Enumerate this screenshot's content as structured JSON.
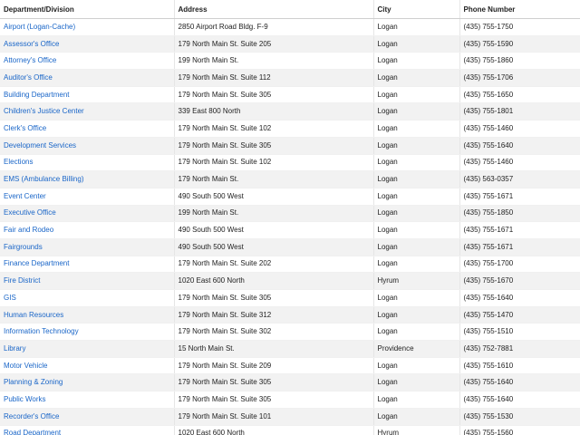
{
  "table": {
    "headers": {
      "department": "Department/Division",
      "address": "Address",
      "city": "City",
      "phone": "Phone Number"
    },
    "link_color": "#1a66c8",
    "rows": [
      {
        "department": "Airport (Logan-Cache)",
        "address": "2850 Airport Road Bldg. F-9",
        "city": "Logan",
        "phone": "(435) 755-1750"
      },
      {
        "department": "Assessor's Office",
        "address": "179 North Main St. Suite 205",
        "city": "Logan",
        "phone": "(435) 755-1590"
      },
      {
        "department": "Attorney's Office",
        "address": "199 North Main St.",
        "city": "Logan",
        "phone": "(435) 755-1860"
      },
      {
        "department": "Auditor's Office",
        "address": "179 North Main St. Suite 112",
        "city": "Logan",
        "phone": "(435) 755-1706"
      },
      {
        "department": "Building Department",
        "address": "179 North Main St. Suite 305",
        "city": "Logan",
        "phone": "(435) 755-1650"
      },
      {
        "department": "Children's Justice Center",
        "address": "339 East 800 North",
        "city": "Logan",
        "phone": "(435) 755-1801"
      },
      {
        "department": "Clerk's Office",
        "address": "179 North Main St. Suite 102",
        "city": "Logan",
        "phone": "(435) 755-1460"
      },
      {
        "department": "Development Services",
        "address": "179 North Main St. Suite 305",
        "city": "Logan",
        "phone": "(435) 755-1640"
      },
      {
        "department": "Elections",
        "address": "179 North Main St. Suite 102",
        "city": "Logan",
        "phone": "(435) 755-1460"
      },
      {
        "department": "EMS (Ambulance Billing)",
        "address": "179 North Main St.",
        "city": "Logan",
        "phone": "(435) 563-0357"
      },
      {
        "department": "Event Center",
        "address": "490 South 500 West",
        "city": "Logan",
        "phone": "(435) 755-1671"
      },
      {
        "department": "Executive Office",
        "address": "199 North Main St.",
        "city": "Logan",
        "phone": "(435) 755-1850"
      },
      {
        "department": "Fair and Rodeo",
        "address": "490 South 500 West",
        "city": "Logan",
        "phone": "(435) 755-1671"
      },
      {
        "department": "Fairgrounds",
        "address": "490 South 500 West",
        "city": "Logan",
        "phone": "(435) 755-1671"
      },
      {
        "department": "Finance Department",
        "address": "179 North Main St. Suite 202",
        "city": "Logan",
        "phone": "(435) 755-1700"
      },
      {
        "department": "Fire District",
        "address": "1020 East 600 North",
        "city": "Hyrum",
        "phone": "(435) 755-1670"
      },
      {
        "department": "GIS",
        "address": "179 North Main St. Suite 305",
        "city": "Logan",
        "phone": "(435) 755-1640"
      },
      {
        "department": "Human Resources",
        "address": "179 North Main St. Suite 312",
        "city": "Logan",
        "phone": "(435) 755-1470"
      },
      {
        "department": "Information Technology",
        "address": "179 North Main St. Suite 302",
        "city": "Logan",
        "phone": "(435) 755-1510"
      },
      {
        "department": "Library",
        "address": "15 North Main St.",
        "city": "Providence",
        "phone": "(435) 752-7881"
      },
      {
        "department": "Motor Vehicle",
        "address": "179 North Main St. Suite 209",
        "city": "Logan",
        "phone": "(435) 755-1610"
      },
      {
        "department": "Planning & Zoning",
        "address": "179 North Main St. Suite 305",
        "city": "Logan",
        "phone": "(435) 755-1640"
      },
      {
        "department": "Public Works",
        "address": "179 North Main St. Suite 305",
        "city": "Logan",
        "phone": "(435) 755-1640"
      },
      {
        "department": "Recorder's Office",
        "address": "179 North Main St. Suite 101",
        "city": "Logan",
        "phone": "(435) 755-1530"
      },
      {
        "department": "Road Department",
        "address": "1020 East 600 North",
        "city": "Hyrum",
        "phone": "(435) 755-1560"
      }
    ]
  }
}
